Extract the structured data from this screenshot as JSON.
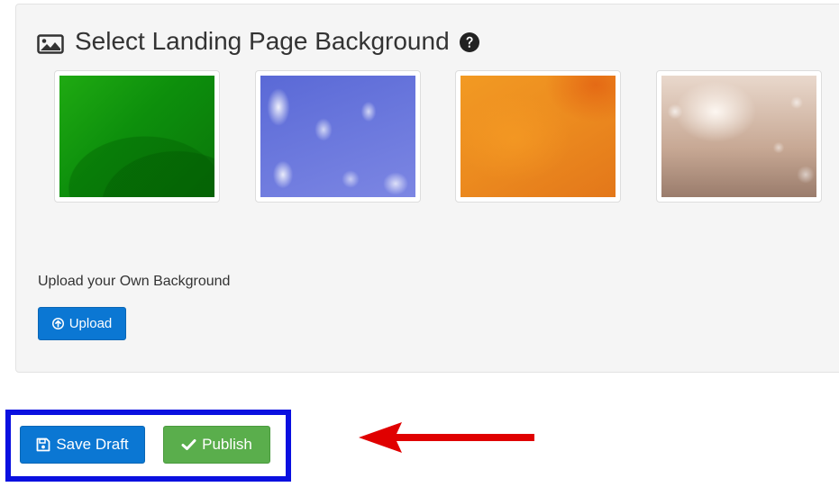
{
  "background_panel": {
    "title": "Select Landing Page Background",
    "title_icon": "image-icon",
    "help_icon": "question-circle-icon",
    "thumbnails": [
      {
        "name": "green"
      },
      {
        "name": "sky"
      },
      {
        "name": "orange"
      },
      {
        "name": "bokeh"
      }
    ],
    "upload_label": "Upload your Own Background",
    "upload_button": {
      "label": "Upload",
      "icon": "arrow-circle-up-icon"
    }
  },
  "actions": {
    "save_draft": {
      "label": "Save Draft",
      "icon": "floppy-disk-icon"
    },
    "publish": {
      "label": "Publish",
      "icon": "checkmark-icon"
    }
  },
  "annotations": {
    "highlight_color": "#0a10e0",
    "arrow_color": "#e00000"
  },
  "colors": {
    "primary_blue": "#0b77d3",
    "success_green": "#5aae4c",
    "panel_bg": "#f5f5f5"
  }
}
